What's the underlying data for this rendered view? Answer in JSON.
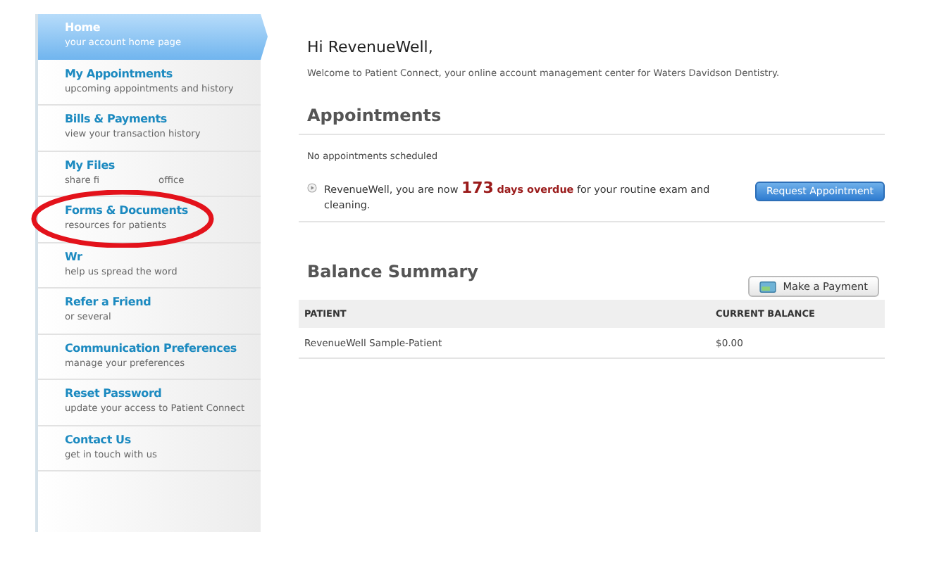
{
  "sidebar": {
    "items": [
      {
        "title": "Home",
        "subtitle": "your account home page",
        "selected": true
      },
      {
        "title": "My Appointments",
        "subtitle": "upcoming appointments and history",
        "selected": false
      },
      {
        "title": "Bills & Payments",
        "subtitle": "view your transaction history",
        "selected": false
      },
      {
        "title": "My Files",
        "subtitle": "share fi",
        "subtitle_tail": "office",
        "selected": false
      },
      {
        "title": "Forms & Documents",
        "subtitle": "resources for patients",
        "selected": false
      },
      {
        "title": "Wr",
        "subtitle": "help us spread the word",
        "selected": false
      },
      {
        "title": "Refer a Friend",
        "subtitle": "or several",
        "selected": false
      },
      {
        "title": "Communication Preferences",
        "subtitle": "manage your preferences",
        "selected": false
      },
      {
        "title": "Reset Password",
        "subtitle": "update your access to Patient Connect",
        "selected": false
      },
      {
        "title": "Contact Us",
        "subtitle": "get in touch with us",
        "selected": false
      }
    ]
  },
  "greeting": "Hi RevenueWell,",
  "welcome": "Welcome to Patient Connect, your online account management center for Waters Davidson Dentistry.",
  "appointments": {
    "heading": "Appointments",
    "empty": "No appointments scheduled",
    "notice": "RevenueWell, you are now **173** **days overdue** for your routine exam and cleaning.",
    "button": "Request Appointment"
  },
  "balance": {
    "heading": "Balance Summary",
    "button": "Make a Payment",
    "columns": [
      "PATIENT",
      "CURRENT BALANCE"
    ],
    "rows": [
      [
        "RevenueWell Sample-Patient",
        "$0.00"
      ]
    ]
  }
}
